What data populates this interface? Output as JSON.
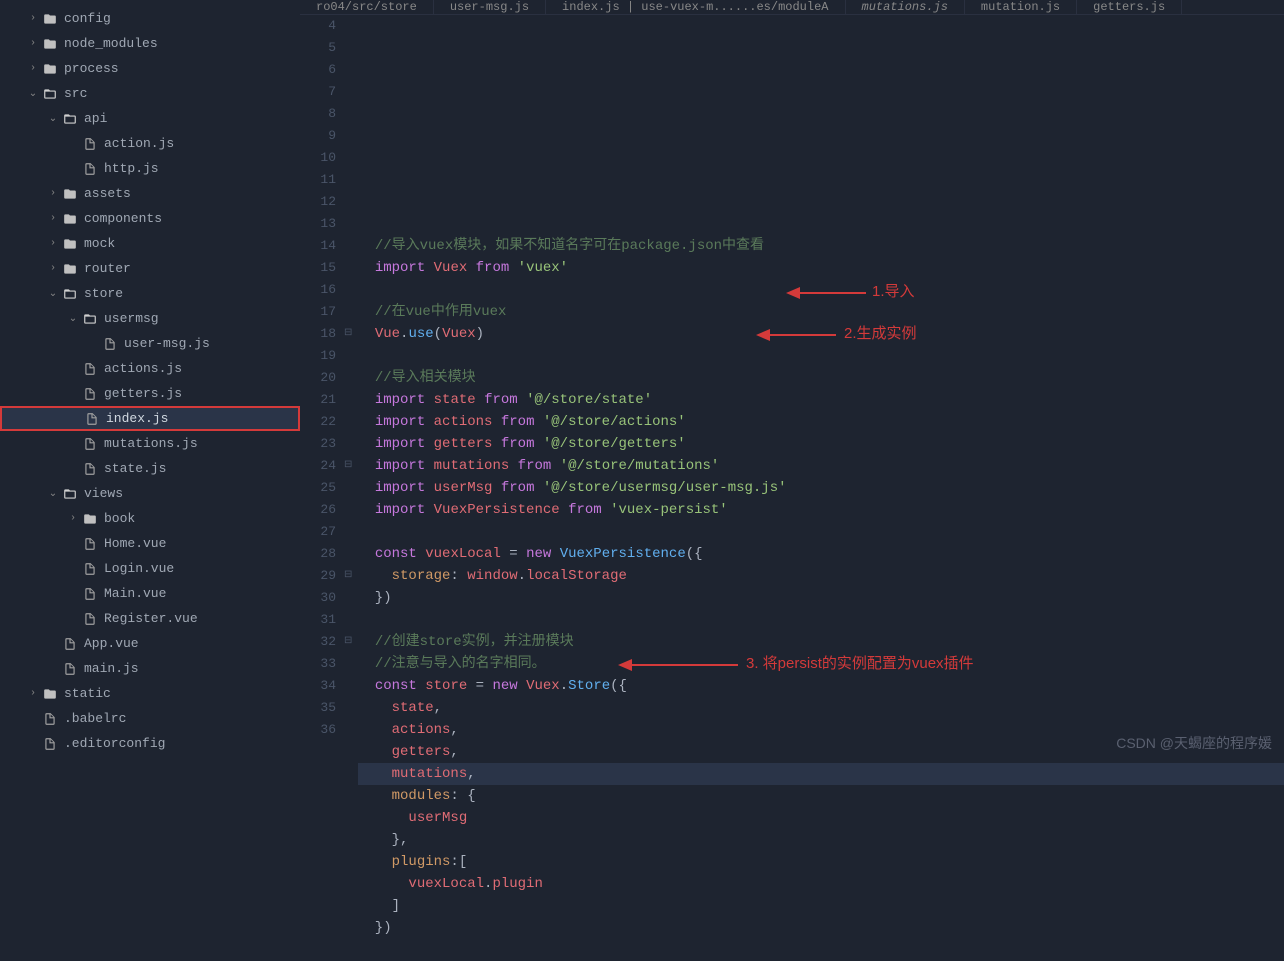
{
  "sidebar": {
    "items": [
      {
        "indent": 1,
        "chevron": "›",
        "type": "folder",
        "label": "config"
      },
      {
        "indent": 1,
        "chevron": "›",
        "type": "folder",
        "label": "node_modules"
      },
      {
        "indent": 1,
        "chevron": "›",
        "type": "folder",
        "label": "process"
      },
      {
        "indent": 1,
        "chevron": "⌄",
        "type": "folder-open",
        "label": "src"
      },
      {
        "indent": 2,
        "chevron": "⌄",
        "type": "folder-open",
        "label": "api"
      },
      {
        "indent": 3,
        "chevron": "",
        "type": "file",
        "label": "action.js"
      },
      {
        "indent": 3,
        "chevron": "",
        "type": "file",
        "label": "http.js"
      },
      {
        "indent": 2,
        "chevron": "›",
        "type": "folder",
        "label": "assets"
      },
      {
        "indent": 2,
        "chevron": "›",
        "type": "folder",
        "label": "components"
      },
      {
        "indent": 2,
        "chevron": "›",
        "type": "folder",
        "label": "mock"
      },
      {
        "indent": 2,
        "chevron": "›",
        "type": "folder",
        "label": "router"
      },
      {
        "indent": 2,
        "chevron": "⌄",
        "type": "folder-open",
        "label": "store"
      },
      {
        "indent": 3,
        "chevron": "⌄",
        "type": "folder-open",
        "label": "usermsg"
      },
      {
        "indent": 4,
        "chevron": "",
        "type": "file",
        "label": "user-msg.js"
      },
      {
        "indent": 3,
        "chevron": "",
        "type": "file",
        "label": "actions.js"
      },
      {
        "indent": 3,
        "chevron": "",
        "type": "file",
        "label": "getters.js"
      },
      {
        "indent": 3,
        "chevron": "",
        "type": "file",
        "label": "index.js",
        "highlighted": true,
        "active": true
      },
      {
        "indent": 3,
        "chevron": "",
        "type": "file",
        "label": "mutations.js"
      },
      {
        "indent": 3,
        "chevron": "",
        "type": "file",
        "label": "state.js"
      },
      {
        "indent": 2,
        "chevron": "⌄",
        "type": "folder-open",
        "label": "views"
      },
      {
        "indent": 3,
        "chevron": "›",
        "type": "folder",
        "label": "book"
      },
      {
        "indent": 3,
        "chevron": "",
        "type": "file",
        "label": "Home.vue"
      },
      {
        "indent": 3,
        "chevron": "",
        "type": "file",
        "label": "Login.vue"
      },
      {
        "indent": 3,
        "chevron": "",
        "type": "file",
        "label": "Main.vue"
      },
      {
        "indent": 3,
        "chevron": "",
        "type": "file",
        "label": "Register.vue"
      },
      {
        "indent": 2,
        "chevron": "",
        "type": "file",
        "label": "App.vue"
      },
      {
        "indent": 2,
        "chevron": "",
        "type": "file",
        "label": "main.js"
      },
      {
        "indent": 1,
        "chevron": "›",
        "type": "folder",
        "label": "static"
      },
      {
        "indent": 1,
        "chevron": "",
        "type": "file",
        "label": ".babelrc"
      },
      {
        "indent": 1,
        "chevron": "",
        "type": "file",
        "label": ".editorconfig"
      }
    ]
  },
  "tabs": [
    {
      "label": "ro04/src/store"
    },
    {
      "label": "user-msg.js"
    },
    {
      "label": "index.js | use-vuex-m......es/moduleA"
    },
    {
      "label": "mutations.js",
      "italic": true
    },
    {
      "label": "mutation.js"
    },
    {
      "label": "getters.js"
    }
  ],
  "editor": {
    "startLine": 4,
    "lines": [
      {
        "n": 4,
        "fold": "",
        "tokens": [
          [
            "  ",
            "d"
          ],
          [
            "//导入vuex模块，如果不知道名字可在package.json中查看",
            "comment"
          ]
        ]
      },
      {
        "n": 5,
        "fold": "",
        "tokens": [
          [
            "  ",
            "d"
          ],
          [
            "import",
            "keyword"
          ],
          [
            " ",
            "d"
          ],
          [
            "Vuex",
            "var"
          ],
          [
            " ",
            "d"
          ],
          [
            "from",
            "keyword"
          ],
          [
            " ",
            "d"
          ],
          [
            "'vuex'",
            "string"
          ]
        ]
      },
      {
        "n": 6,
        "fold": "",
        "tokens": []
      },
      {
        "n": 7,
        "fold": "",
        "tokens": [
          [
            "  ",
            "d"
          ],
          [
            "//在vue中作用vuex",
            "comment"
          ]
        ]
      },
      {
        "n": 8,
        "fold": "",
        "tokens": [
          [
            "  ",
            "d"
          ],
          [
            "Vue",
            "var"
          ],
          [
            ".",
            "punct"
          ],
          [
            "use",
            "func"
          ],
          [
            "(",
            "punct"
          ],
          [
            "Vuex",
            "var"
          ],
          [
            ")",
            "punct"
          ]
        ]
      },
      {
        "n": 9,
        "fold": "",
        "tokens": []
      },
      {
        "n": 10,
        "fold": "",
        "tokens": [
          [
            "  ",
            "d"
          ],
          [
            "//导入相关模块",
            "comment"
          ]
        ]
      },
      {
        "n": 11,
        "fold": "",
        "tokens": [
          [
            "  ",
            "d"
          ],
          [
            "import",
            "keyword"
          ],
          [
            " ",
            "d"
          ],
          [
            "state",
            "var"
          ],
          [
            " ",
            "d"
          ],
          [
            "from",
            "keyword"
          ],
          [
            " ",
            "d"
          ],
          [
            "'@/store/state'",
            "string"
          ]
        ]
      },
      {
        "n": 12,
        "fold": "",
        "tokens": [
          [
            "  ",
            "d"
          ],
          [
            "import",
            "keyword"
          ],
          [
            " ",
            "d"
          ],
          [
            "actions",
            "var"
          ],
          [
            " ",
            "d"
          ],
          [
            "from",
            "keyword"
          ],
          [
            " ",
            "d"
          ],
          [
            "'@/store/actions'",
            "string"
          ]
        ]
      },
      {
        "n": 13,
        "fold": "",
        "tokens": [
          [
            "  ",
            "d"
          ],
          [
            "import",
            "keyword"
          ],
          [
            " ",
            "d"
          ],
          [
            "getters",
            "var"
          ],
          [
            " ",
            "d"
          ],
          [
            "from",
            "keyword"
          ],
          [
            " ",
            "d"
          ],
          [
            "'@/store/getters'",
            "string"
          ]
        ]
      },
      {
        "n": 14,
        "fold": "",
        "tokens": [
          [
            "  ",
            "d"
          ],
          [
            "import",
            "keyword"
          ],
          [
            " ",
            "d"
          ],
          [
            "mutations",
            "var"
          ],
          [
            " ",
            "d"
          ],
          [
            "from",
            "keyword"
          ],
          [
            " ",
            "d"
          ],
          [
            "'@/store/mutations'",
            "string"
          ]
        ]
      },
      {
        "n": 15,
        "fold": "",
        "tokens": [
          [
            "  ",
            "d"
          ],
          [
            "import",
            "keyword"
          ],
          [
            " ",
            "d"
          ],
          [
            "userMsg",
            "var"
          ],
          [
            " ",
            "d"
          ],
          [
            "from",
            "keyword"
          ],
          [
            " ",
            "d"
          ],
          [
            "'@/store/usermsg/user-msg.js'",
            "string"
          ]
        ]
      },
      {
        "n": 16,
        "fold": "",
        "tokens": [
          [
            "  ",
            "d"
          ],
          [
            "import",
            "keyword"
          ],
          [
            " ",
            "d"
          ],
          [
            "VuexPersistence",
            "var"
          ],
          [
            " ",
            "d"
          ],
          [
            "from",
            "keyword"
          ],
          [
            " ",
            "d"
          ],
          [
            "'vuex-persist'",
            "string"
          ]
        ]
      },
      {
        "n": 17,
        "fold": "",
        "tokens": []
      },
      {
        "n": 18,
        "fold": "⊟",
        "tokens": [
          [
            "  ",
            "d"
          ],
          [
            "const",
            "keyword"
          ],
          [
            " ",
            "d"
          ],
          [
            "vuexLocal",
            "var"
          ],
          [
            " = ",
            "punct"
          ],
          [
            "new",
            "keyword"
          ],
          [
            " ",
            "d"
          ],
          [
            "VuexPersistence",
            "func"
          ],
          [
            "({",
            "punct"
          ]
        ]
      },
      {
        "n": 19,
        "fold": "",
        "tokens": [
          [
            "    ",
            "d"
          ],
          [
            "storage",
            "prop"
          ],
          [
            ": ",
            "punct"
          ],
          [
            "window",
            "var"
          ],
          [
            ".",
            "punct"
          ],
          [
            "localStorage",
            "var"
          ]
        ]
      },
      {
        "n": 20,
        "fold": "",
        "tokens": [
          [
            "  })",
            "punct"
          ]
        ]
      },
      {
        "n": 21,
        "fold": "",
        "tokens": []
      },
      {
        "n": 22,
        "fold": "",
        "tokens": [
          [
            "  ",
            "d"
          ],
          [
            "//创建store实例，并注册模块",
            "comment"
          ]
        ]
      },
      {
        "n": 23,
        "fold": "",
        "tokens": [
          [
            "  ",
            "d"
          ],
          [
            "//注意与导入的名字相同。",
            "comment"
          ]
        ]
      },
      {
        "n": 24,
        "fold": "⊟",
        "tokens": [
          [
            "  ",
            "d"
          ],
          [
            "const",
            "keyword"
          ],
          [
            " ",
            "d"
          ],
          [
            "store",
            "var"
          ],
          [
            " = ",
            "punct"
          ],
          [
            "new",
            "keyword"
          ],
          [
            " ",
            "d"
          ],
          [
            "Vuex",
            "var"
          ],
          [
            ".",
            "punct"
          ],
          [
            "Store",
            "func"
          ],
          [
            "({",
            "punct"
          ]
        ]
      },
      {
        "n": 25,
        "fold": "",
        "tokens": [
          [
            "    ",
            "d"
          ],
          [
            "state",
            "var"
          ],
          [
            ",",
            "punct"
          ]
        ]
      },
      {
        "n": 26,
        "fold": "",
        "tokens": [
          [
            "    ",
            "d"
          ],
          [
            "actions",
            "var"
          ],
          [
            ",",
            "punct"
          ]
        ]
      },
      {
        "n": 27,
        "fold": "",
        "tokens": [
          [
            "    ",
            "d"
          ],
          [
            "getters",
            "var"
          ],
          [
            ",",
            "punct"
          ]
        ]
      },
      {
        "n": 28,
        "fold": "",
        "tokens": [
          [
            "    ",
            "d"
          ],
          [
            "mutations",
            "var"
          ],
          [
            ",",
            "punct"
          ]
        ],
        "current": true
      },
      {
        "n": 29,
        "fold": "⊟",
        "tokens": [
          [
            "    ",
            "d"
          ],
          [
            "modules",
            "prop"
          ],
          [
            ": {",
            "punct"
          ]
        ]
      },
      {
        "n": 30,
        "fold": "",
        "tokens": [
          [
            "      ",
            "d"
          ],
          [
            "userMsg",
            "var"
          ]
        ]
      },
      {
        "n": 31,
        "fold": "",
        "tokens": [
          [
            "    },",
            "punct"
          ]
        ]
      },
      {
        "n": 32,
        "fold": "⊟",
        "tokens": [
          [
            "    ",
            "d"
          ],
          [
            "plugins",
            "prop"
          ],
          [
            ":[",
            "punct"
          ]
        ]
      },
      {
        "n": 33,
        "fold": "",
        "tokens": [
          [
            "      ",
            "d"
          ],
          [
            "vuexLocal",
            "var"
          ],
          [
            ".",
            "punct"
          ],
          [
            "plugin",
            "var"
          ]
        ]
      },
      {
        "n": 34,
        "fold": "",
        "tokens": [
          [
            "    ]",
            "punct"
          ]
        ]
      },
      {
        "n": 35,
        "fold": "",
        "tokens": [
          [
            "  })",
            "punct"
          ]
        ]
      },
      {
        "n": 36,
        "fold": "",
        "tokens": []
      }
    ]
  },
  "annotations": {
    "a1": "1.导入",
    "a2": "2.生成实例",
    "a3": "3. 将persist的实例配置为vuex插件"
  },
  "watermark": "CSDN @天蝎座的程序媛"
}
